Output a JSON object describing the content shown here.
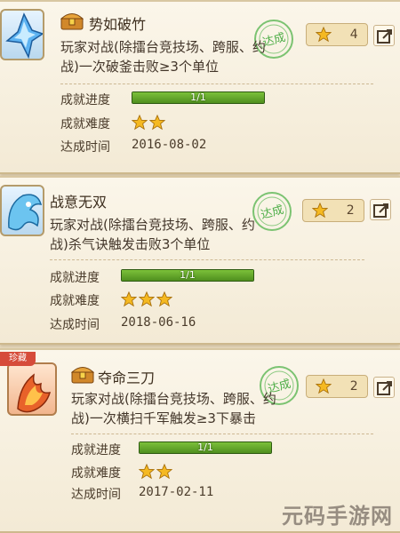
{
  "achievements": [
    {
      "title": "势如破竹",
      "description_line1": "玩家对战(除擂台竞技场、跨服、约",
      "description_line2": "战)一次破釜击败≥3个单位",
      "points": "4",
      "stamp_label": "达成",
      "progress_label": "成就进度",
      "progress_text": "1/1",
      "progress_fraction": 1.0,
      "difficulty_label": "成就难度",
      "difficulty_stars": 2,
      "time_label": "达成时间",
      "time_value": "2016-08-02",
      "icon": "ice-crystal-icon"
    },
    {
      "title": "战意无双",
      "description_line1": "玩家对战(除擂台竞技场、跨服、约",
      "description_line2": "战)杀气诀触发击败3个单位",
      "points": "2",
      "stamp_label": "达成",
      "progress_label": "成就进度",
      "progress_text": "1/1",
      "progress_fraction": 1.0,
      "difficulty_label": "成就难度",
      "difficulty_stars": 3,
      "time_label": "达成时间",
      "time_value": "2018-06-16",
      "icon": "ice-dragon-icon"
    },
    {
      "title": "夺命三刀",
      "description_line1": "玩家对战(除擂台竞技场、跨服、约",
      "description_line2": "战)一次横扫千军触发≥3下暴击",
      "points": "2",
      "stamp_label": "达成",
      "progress_label": "成就进度",
      "progress_text": "1/1",
      "progress_fraction": 1.0,
      "difficulty_label": "成就难度",
      "difficulty_stars": 2,
      "time_label": "达成时间",
      "time_value": "2017-02-11",
      "icon": "fire-blade-icon",
      "badge": "珍藏"
    }
  ],
  "watermark": "元码手游网",
  "colors": {
    "card_bg": "#f6efdf",
    "progress_green": "#5a9a25",
    "star_gold": "#f5b921",
    "stamp_green": "#4fb04a"
  }
}
